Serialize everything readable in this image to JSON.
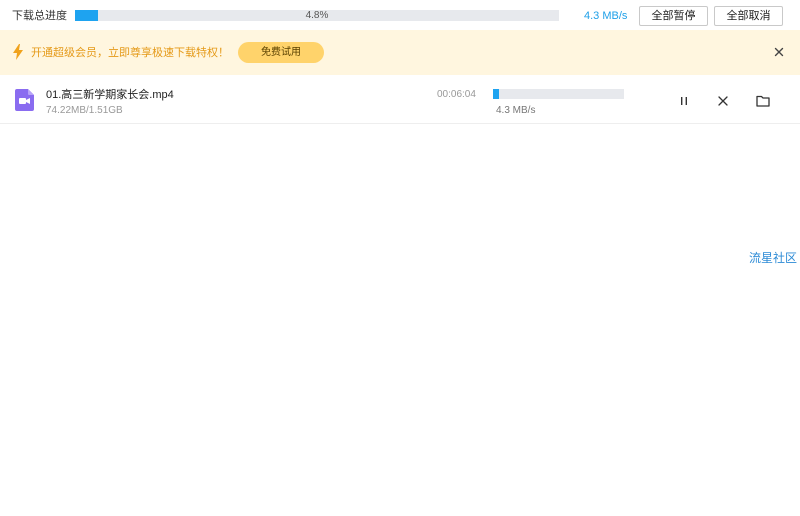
{
  "topbar": {
    "label": "下载总进度",
    "progress_text": "4.8%",
    "progress_value": 0.048,
    "speed": "4.3 MB/s",
    "pause_all_label": "全部暂停",
    "cancel_all_label": "全部取消"
  },
  "banner": {
    "icon": "lightning-icon",
    "text": "开通超级会员，立即尊享极速下载特权！",
    "trial_button_label": "免费试用",
    "close_icon": "close-icon"
  },
  "download": {
    "file_icon": "video-file-icon",
    "filename": "01.高三新学期家长会.mp4",
    "size": "74.22MB/1.51GB",
    "remaining_time": "00:06:04",
    "progress_value": 0.048,
    "speed": "4.3 MB/s",
    "actions": [
      "pause-icon",
      "close-icon",
      "folder-icon"
    ]
  },
  "watermark": "流星社区",
  "colors": {
    "accent": "#1ea3f0",
    "banner_bg": "#fff6df",
    "banner_text": "#e59a19",
    "trial_button": "#ffd36b",
    "file_icon": "#8a6cf0"
  }
}
